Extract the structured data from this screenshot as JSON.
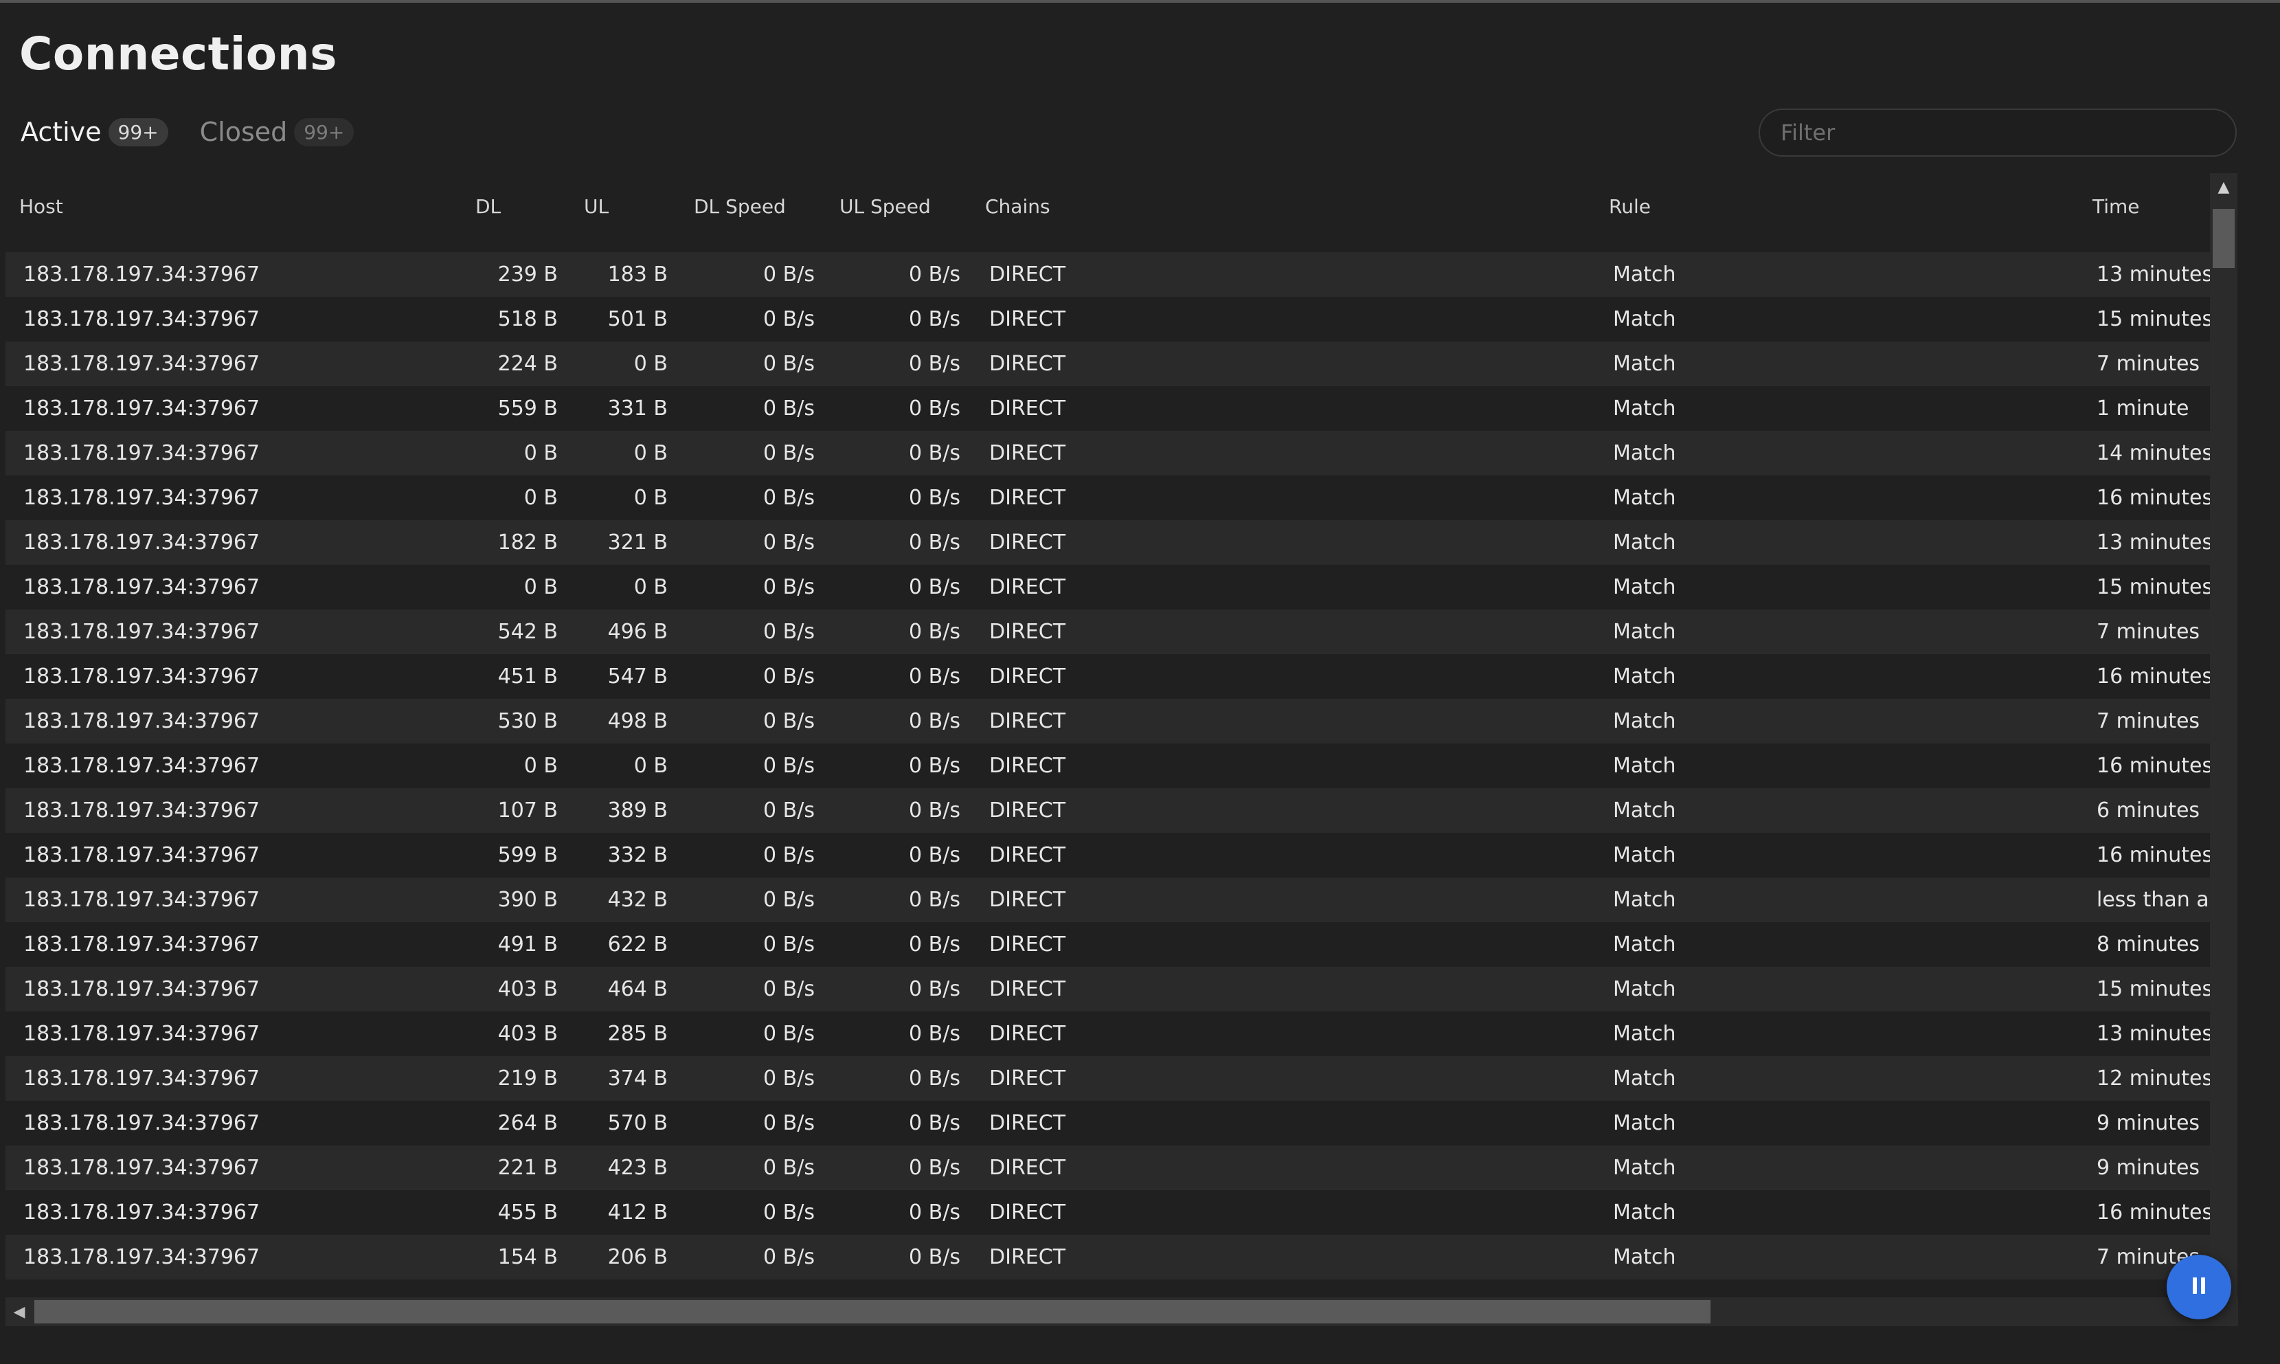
{
  "page": {
    "title": "Connections"
  },
  "tabs": [
    {
      "label": "Active",
      "badge": "99+"
    },
    {
      "label": "Closed",
      "badge": "99+"
    }
  ],
  "filter": {
    "placeholder": "Filter",
    "value": ""
  },
  "table": {
    "headers": {
      "host": "Host",
      "dl": "DL",
      "ul": "UL",
      "dl_speed": "DL Speed",
      "ul_speed": "UL Speed",
      "chains": "Chains",
      "rule": "Rule",
      "time": "Time"
    },
    "rows": [
      {
        "host": "183.178.197.34:37967",
        "dl": "239 B",
        "ul": "183 B",
        "dl_speed": "0 B/s",
        "ul_speed": "0 B/s",
        "chains": "DIRECT",
        "rule": "Match",
        "time": "13 minutes"
      },
      {
        "host": "183.178.197.34:37967",
        "dl": "518 B",
        "ul": "501 B",
        "dl_speed": "0 B/s",
        "ul_speed": "0 B/s",
        "chains": "DIRECT",
        "rule": "Match",
        "time": "15 minutes"
      },
      {
        "host": "183.178.197.34:37967",
        "dl": "224 B",
        "ul": "0 B",
        "dl_speed": "0 B/s",
        "ul_speed": "0 B/s",
        "chains": "DIRECT",
        "rule": "Match",
        "time": "7 minutes"
      },
      {
        "host": "183.178.197.34:37967",
        "dl": "559 B",
        "ul": "331 B",
        "dl_speed": "0 B/s",
        "ul_speed": "0 B/s",
        "chains": "DIRECT",
        "rule": "Match",
        "time": "1 minute"
      },
      {
        "host": "183.178.197.34:37967",
        "dl": "0 B",
        "ul": "0 B",
        "dl_speed": "0 B/s",
        "ul_speed": "0 B/s",
        "chains": "DIRECT",
        "rule": "Match",
        "time": "14 minutes"
      },
      {
        "host": "183.178.197.34:37967",
        "dl": "0 B",
        "ul": "0 B",
        "dl_speed": "0 B/s",
        "ul_speed": "0 B/s",
        "chains": "DIRECT",
        "rule": "Match",
        "time": "16 minutes"
      },
      {
        "host": "183.178.197.34:37967",
        "dl": "182 B",
        "ul": "321 B",
        "dl_speed": "0 B/s",
        "ul_speed": "0 B/s",
        "chains": "DIRECT",
        "rule": "Match",
        "time": "13 minutes"
      },
      {
        "host": "183.178.197.34:37967",
        "dl": "0 B",
        "ul": "0 B",
        "dl_speed": "0 B/s",
        "ul_speed": "0 B/s",
        "chains": "DIRECT",
        "rule": "Match",
        "time": "15 minutes"
      },
      {
        "host": "183.178.197.34:37967",
        "dl": "542 B",
        "ul": "496 B",
        "dl_speed": "0 B/s",
        "ul_speed": "0 B/s",
        "chains": "DIRECT",
        "rule": "Match",
        "time": "7 minutes"
      },
      {
        "host": "183.178.197.34:37967",
        "dl": "451 B",
        "ul": "547 B",
        "dl_speed": "0 B/s",
        "ul_speed": "0 B/s",
        "chains": "DIRECT",
        "rule": "Match",
        "time": "16 minutes"
      },
      {
        "host": "183.178.197.34:37967",
        "dl": "530 B",
        "ul": "498 B",
        "dl_speed": "0 B/s",
        "ul_speed": "0 B/s",
        "chains": "DIRECT",
        "rule": "Match",
        "time": "7 minutes"
      },
      {
        "host": "183.178.197.34:37967",
        "dl": "0 B",
        "ul": "0 B",
        "dl_speed": "0 B/s",
        "ul_speed": "0 B/s",
        "chains": "DIRECT",
        "rule": "Match",
        "time": "16 minutes"
      },
      {
        "host": "183.178.197.34:37967",
        "dl": "107 B",
        "ul": "389 B",
        "dl_speed": "0 B/s",
        "ul_speed": "0 B/s",
        "chains": "DIRECT",
        "rule": "Match",
        "time": "6 minutes"
      },
      {
        "host": "183.178.197.34:37967",
        "dl": "599 B",
        "ul": "332 B",
        "dl_speed": "0 B/s",
        "ul_speed": "0 B/s",
        "chains": "DIRECT",
        "rule": "Match",
        "time": "16 minutes"
      },
      {
        "host": "183.178.197.34:37967",
        "dl": "390 B",
        "ul": "432 B",
        "dl_speed": "0 B/s",
        "ul_speed": "0 B/s",
        "chains": "DIRECT",
        "rule": "Match",
        "time": "less than a r"
      },
      {
        "host": "183.178.197.34:37967",
        "dl": "491 B",
        "ul": "622 B",
        "dl_speed": "0 B/s",
        "ul_speed": "0 B/s",
        "chains": "DIRECT",
        "rule": "Match",
        "time": "8 minutes"
      },
      {
        "host": "183.178.197.34:37967",
        "dl": "403 B",
        "ul": "464 B",
        "dl_speed": "0 B/s",
        "ul_speed": "0 B/s",
        "chains": "DIRECT",
        "rule": "Match",
        "time": "15 minutes"
      },
      {
        "host": "183.178.197.34:37967",
        "dl": "403 B",
        "ul": "285 B",
        "dl_speed": "0 B/s",
        "ul_speed": "0 B/s",
        "chains": "DIRECT",
        "rule": "Match",
        "time": "13 minutes"
      },
      {
        "host": "183.178.197.34:37967",
        "dl": "219 B",
        "ul": "374 B",
        "dl_speed": "0 B/s",
        "ul_speed": "0 B/s",
        "chains": "DIRECT",
        "rule": "Match",
        "time": "12 minutes"
      },
      {
        "host": "183.178.197.34:37967",
        "dl": "264 B",
        "ul": "570 B",
        "dl_speed": "0 B/s",
        "ul_speed": "0 B/s",
        "chains": "DIRECT",
        "rule": "Match",
        "time": "9 minutes"
      },
      {
        "host": "183.178.197.34:37967",
        "dl": "221 B",
        "ul": "423 B",
        "dl_speed": "0 B/s",
        "ul_speed": "0 B/s",
        "chains": "DIRECT",
        "rule": "Match",
        "time": "9 minutes"
      },
      {
        "host": "183.178.197.34:37967",
        "dl": "455 B",
        "ul": "412 B",
        "dl_speed": "0 B/s",
        "ul_speed": "0 B/s",
        "chains": "DIRECT",
        "rule": "Match",
        "time": "16 minutes"
      },
      {
        "host": "183.178.197.34:37967",
        "dl": "154 B",
        "ul": "206 B",
        "dl_speed": "0 B/s",
        "ul_speed": "0 B/s",
        "chains": "DIRECT",
        "rule": "Match",
        "time": "7 minutes"
      }
    ]
  },
  "icons": {
    "scroll_up": "triangle-up-icon",
    "scroll_left": "triangle-left-icon",
    "fab": "pause-icon"
  },
  "colors": {
    "background": "#202020",
    "row_alt": "#2a2a2a",
    "accent": "#2f6fe0"
  }
}
